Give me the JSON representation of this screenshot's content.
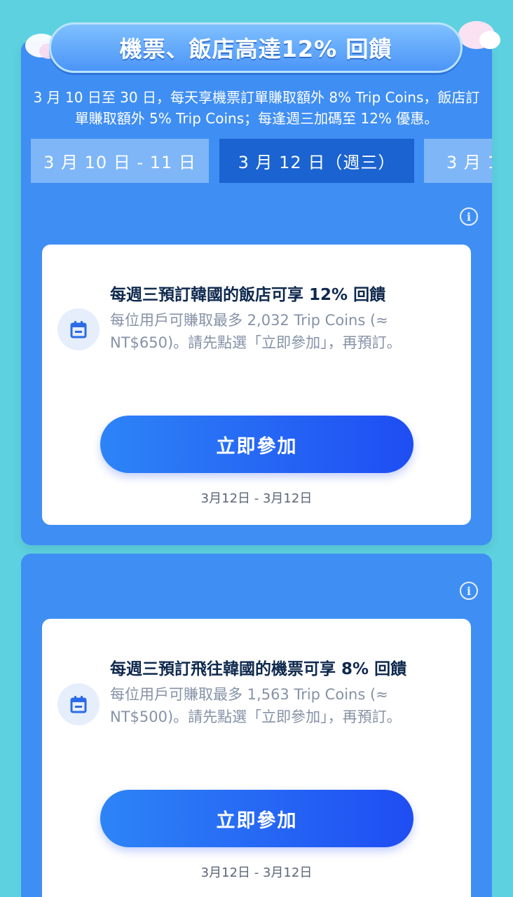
{
  "header": {
    "title": "機票、飯店高達12% 回饋",
    "description": "3 月 10 日至 30 日，每天享機票訂單賺取額外 8% Trip Coins，飯店訂單賺取額外 5% Trip Coins；每逢週三加碼至 12% 優惠。"
  },
  "date_tabs": [
    {
      "label": "3 月 10 日 - 11 日",
      "selected": false
    },
    {
      "label": "3 月 12 日（週三）",
      "selected": true
    },
    {
      "label": "3 月 1",
      "selected": false
    }
  ],
  "offers": [
    {
      "icon": "calendar-icon",
      "title": "每週三預訂韓國的飯店可享 12% 回饋",
      "description": "每位用戶可賺取最多 2,032 Trip Coins (≈ NT$650)。請先點選「立即參加」，再預訂。",
      "button_label": "立即參加",
      "date_range": "3月12日 - 3月12日"
    },
    {
      "icon": "calendar-icon",
      "title": "每週三預訂飛往韓國的機票可享 8% 回饋",
      "description": "每位用戶可賺取最多 1,563 Trip Coins (≈ NT$500)。請先點選「立即參加」，再預訂。",
      "button_label": "立即參加",
      "date_range": "3月12日 - 3月12日"
    }
  ],
  "info_icon_glyph": "i",
  "colors": {
    "background": "#5dd1df",
    "panel": "#3f8ef3",
    "tab_selected": "#1a63d0",
    "tab_unselected": "#7fb6f7",
    "button_start": "#2d84f6",
    "button_end": "#1f4df3",
    "title_text": "#0f294d",
    "desc_text": "#8592a6"
  }
}
